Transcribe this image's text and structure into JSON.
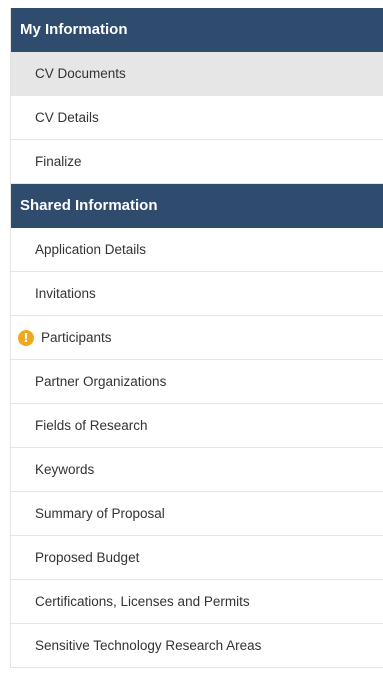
{
  "sections": [
    {
      "title": "My Information",
      "items": [
        {
          "label": "CV Documents"
        },
        {
          "label": "CV Details"
        },
        {
          "label": "Finalize"
        }
      ]
    },
    {
      "title": "Shared Information",
      "items": [
        {
          "label": "Application Details"
        },
        {
          "label": "Invitations"
        },
        {
          "label": "Participants",
          "icon": "warning-icon",
          "icon_glyph": "!"
        },
        {
          "label": "Partner Organizations"
        },
        {
          "label": "Fields of Research"
        },
        {
          "label": "Keywords"
        },
        {
          "label": "Summary of Proposal"
        },
        {
          "label": "Proposed Budget"
        },
        {
          "label": "Certifications, Licenses and Permits"
        },
        {
          "label": "Sensitive Technology Research Areas"
        }
      ]
    }
  ],
  "colors": {
    "header_bg": "#2f4b6e",
    "active_bg": "#e6e6e6",
    "warning": "#f0a91e"
  }
}
